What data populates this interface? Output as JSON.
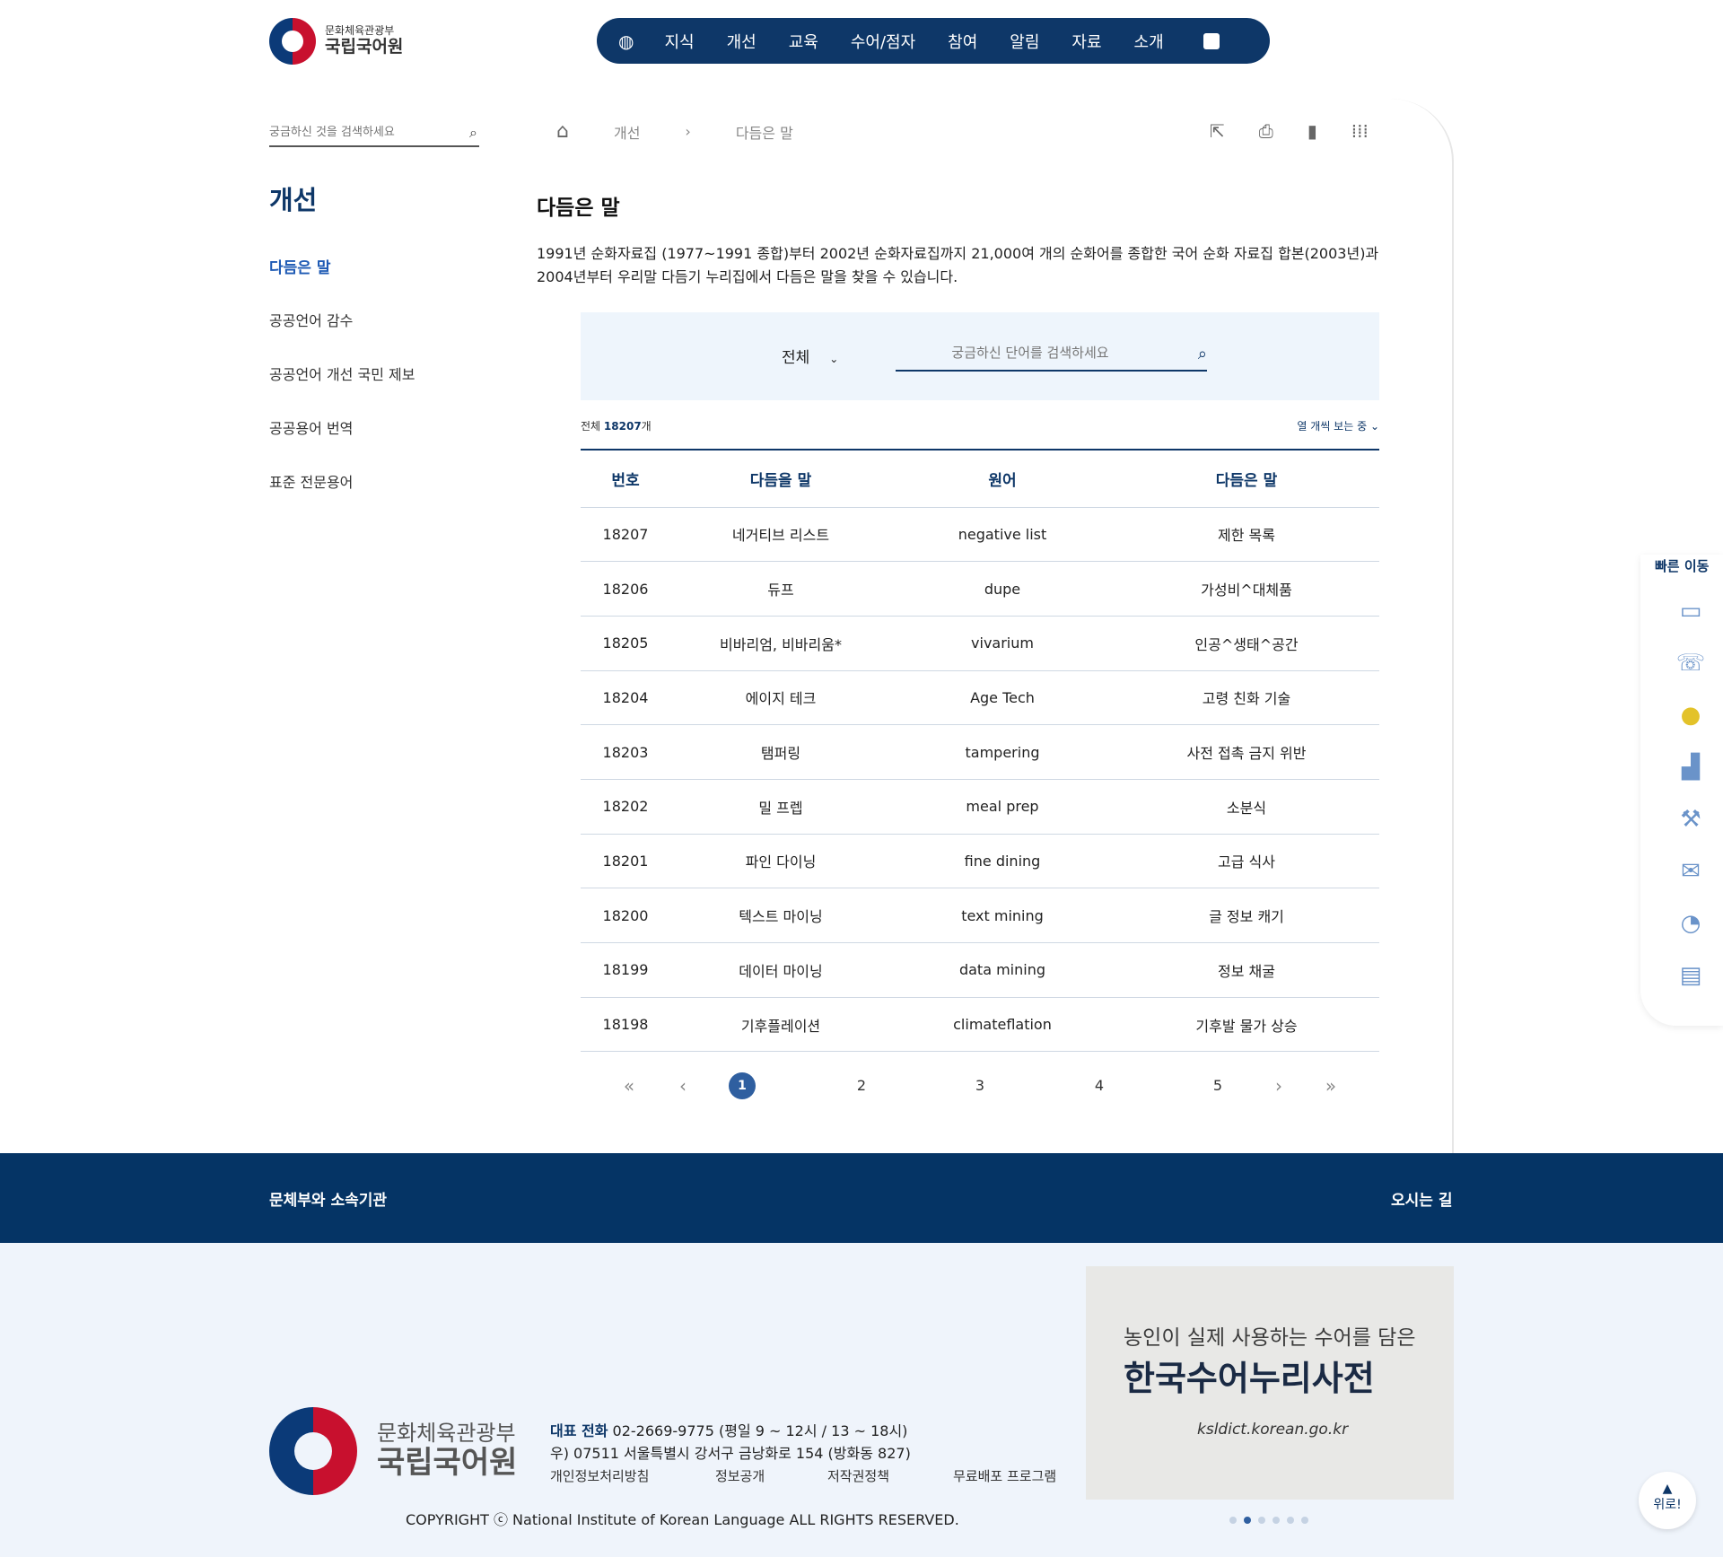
{
  "header": {
    "logo_sub": "문화체육관광부",
    "logo_main": "국립국어원",
    "menu": [
      "지식",
      "개선",
      "교육",
      "수어/점자",
      "참여",
      "알림",
      "자료",
      "소개"
    ]
  },
  "sidebar": {
    "search_placeholder": "궁금하신 것을 검색하세요",
    "title": "개선",
    "items": [
      "다듬은 말",
      "공공언어 감수",
      "공공언어 개선 국민 제보",
      "공공용어 번역",
      "표준 전문용어"
    ]
  },
  "breadcrumb": {
    "level1": "개선",
    "level2": "다듬은 말"
  },
  "page": {
    "title": "다듬은 말",
    "description": "1991년 순화자료집 (1977~1991 종합)부터 2002년 순화자료집까지 21,000여 개의 순화어를 종합한 국어 순화 자료집 합본(2003년)과 2004년부터 우리말 다듬기 누리집에서 다듬은 말을 찾을 수 있습니다."
  },
  "search": {
    "select_value": "전체",
    "placeholder": "궁금하신 단어를 검색하세요"
  },
  "meta": {
    "total_label": "전체",
    "total_count": "18207",
    "total_unit": "개",
    "view_label": "열 개씩 보는 중"
  },
  "table": {
    "headers": [
      "번호",
      "다듬을 말",
      "원어",
      "다듬은 말"
    ],
    "rows": [
      [
        "18207",
        "네거티브 리스트",
        "negative list",
        "제한 목록"
      ],
      [
        "18206",
        "듀프",
        "dupe",
        "가성비^대체품"
      ],
      [
        "18205",
        "비바리엄, 비바리움*",
        "vivarium",
        "인공^생태^공간"
      ],
      [
        "18204",
        "에이지 테크",
        "Age Tech",
        "고령 친화 기술"
      ],
      [
        "18203",
        "탬퍼링",
        "tampering",
        "사전 접촉 금지 위반"
      ],
      [
        "18202",
        "밀 프렙",
        "meal prep",
        "소분식"
      ],
      [
        "18201",
        "파인 다이닝",
        "fine dining",
        "고급 식사"
      ],
      [
        "18200",
        "텍스트 마이닝",
        "text mining",
        "글 정보 캐기"
      ],
      [
        "18199",
        "데이터 마이닝",
        "data mining",
        "정보 채굴"
      ],
      [
        "18198",
        "기후플레이션",
        "climateflation",
        "기후발 물가 상승"
      ]
    ]
  },
  "pagination": {
    "pages": [
      "1",
      "2",
      "3",
      "4",
      "5"
    ],
    "current": "1"
  },
  "quick": {
    "title": "빠른 이동"
  },
  "footer": {
    "bar_left": "문체부와 소속기관",
    "bar_right": "오시는 길",
    "logo_sub": "문화체육관광부",
    "logo_main": "국립국어원",
    "phone_label": "대표 전화",
    "phone_text": "02-2669-9775 (평일 9 ~ 12시 / 13 ~ 18시)",
    "address": "우) 07511 서울특별시 강서구 금낭화로 154 (방화동 827)",
    "links": [
      "개인정보처리방침",
      "정보공개",
      "저작권정책",
      "무료배포 프로그램"
    ],
    "copyright": "COPYRIGHT ⓒ National Institute of Korean Language ALL RIGHTS RESERVED."
  },
  "banner": {
    "sub": "농인이 실제 사용하는 수어를 담은",
    "main": "한국수어누리사전",
    "url": "ksldict.korean.go.kr"
  },
  "top_button": {
    "arrow": "▲",
    "label": "위로!"
  },
  "colors": {
    "navy": "#0e3768",
    "accent": "#2f5fa0",
    "footer": "#053465",
    "footer_bg": "#eff4fb"
  }
}
